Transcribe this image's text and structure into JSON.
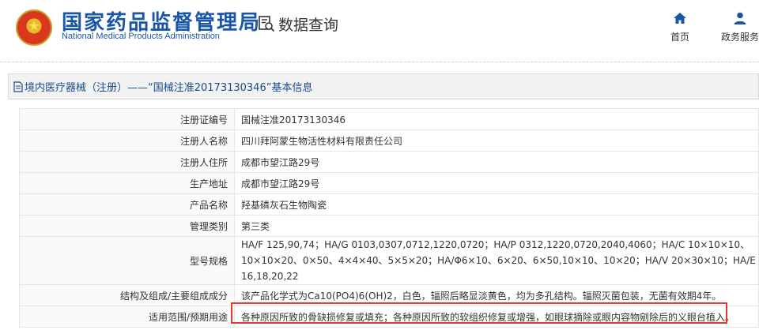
{
  "header": {
    "brand_cn": "国家药品监督管理局",
    "brand_en": "National Medical Products Administration",
    "query_label": "数据查询",
    "nav": [
      {
        "label": "首页",
        "icon": "home-icon"
      },
      {
        "label": "政务服务",
        "icon": "user-icon"
      }
    ]
  },
  "title_bar": {
    "text": "境内医疗器械（注册）——“国械注准20173130346”基本信息",
    "icon": "document-icon"
  },
  "info_rows": [
    {
      "key": "注册证编号",
      "value": "国械注准20173130346"
    },
    {
      "key": "注册人名称",
      "value": "四川拜阿蒙生物活性材料有限责任公司"
    },
    {
      "key": "注册人住所",
      "value": "成都市望江路29号"
    },
    {
      "key": "生产地址",
      "value": "成都市望江路29号"
    },
    {
      "key": "产品名称",
      "value": "羟基磷灰石生物陶瓷"
    },
    {
      "key": "管理类别",
      "value": "第三类"
    },
    {
      "key": "型号规格",
      "value": "HA/F 125,90,74；HA/G 0103,0307,0712,1220,0720；HA/P 0312,1220,0720,2040,4060；HA/C 10×10×10、10×10×20、0×50、4×4×40、5×5×20；HA/Φ6×10、6×20、6×50,10×10、10×20；HA/V 20×30×10；HA/E 16,18,20,22"
    },
    {
      "key": "结构及组成/主要组成成分",
      "value": "该产品化学式为Ca10(PO4)6(OH)2，白色，辐照后略显淡黄色，均为多孔结构。辐照灭菌包装，无菌有效期4年。"
    },
    {
      "key": "适用范围/预期用途",
      "value": "各种原因所致的骨缺损修复或填充；各种原因所致的软组织修复或增强，如眼球摘除或眼内容物剜除后的义眼台植入。"
    }
  ],
  "colors": {
    "brand_blue": "#1a56a8",
    "title_text": "#1a4b8a",
    "highlight_border": "#e53935"
  }
}
